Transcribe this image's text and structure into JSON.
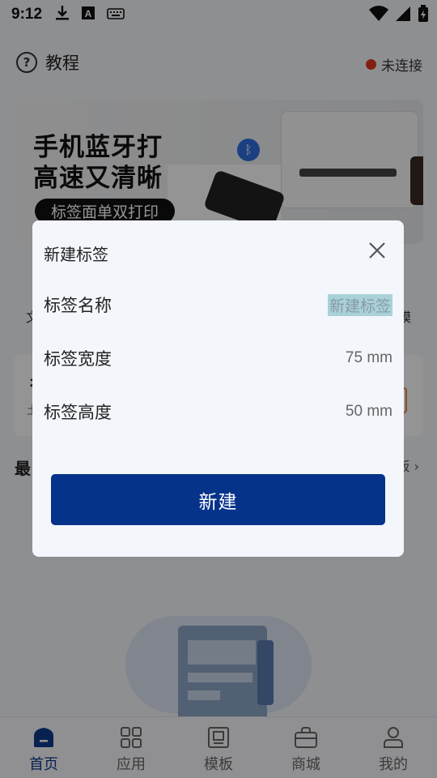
{
  "statusbar": {
    "time": "9:12"
  },
  "header": {
    "title": "教程",
    "connection_status": "未连接"
  },
  "banner": {
    "line1": "手机蓝牙打",
    "line2": "高速又清晰",
    "tag": "标签面单双打印"
  },
  "background": {
    "category_left": "文",
    "category_right": "模",
    "card_title": "彳",
    "card_sub": "土",
    "recent_title": "最",
    "recent_more": "板 ›"
  },
  "dialog": {
    "title": "新建标签",
    "rows": [
      {
        "label": "标签名称",
        "value": "新建标签"
      },
      {
        "label": "标签宽度",
        "value": "75 mm"
      },
      {
        "label": "标签高度",
        "value": "50 mm"
      }
    ],
    "create_label": "新建"
  },
  "bottomnav": {
    "items": [
      {
        "label": "首页",
        "icon": "home-icon"
      },
      {
        "label": "应用",
        "icon": "apps-grid-icon"
      },
      {
        "label": "模板",
        "icon": "template-icon"
      },
      {
        "label": "商城",
        "icon": "shop-bag-icon"
      },
      {
        "label": "我的",
        "icon": "profile-icon"
      }
    ],
    "active_index": 0
  },
  "colors": {
    "primary": "#053389",
    "active_nav": "#0f3a8c",
    "status_dot": "#e03a1e",
    "overlay": "rgba(0,0,0,0.42)"
  }
}
